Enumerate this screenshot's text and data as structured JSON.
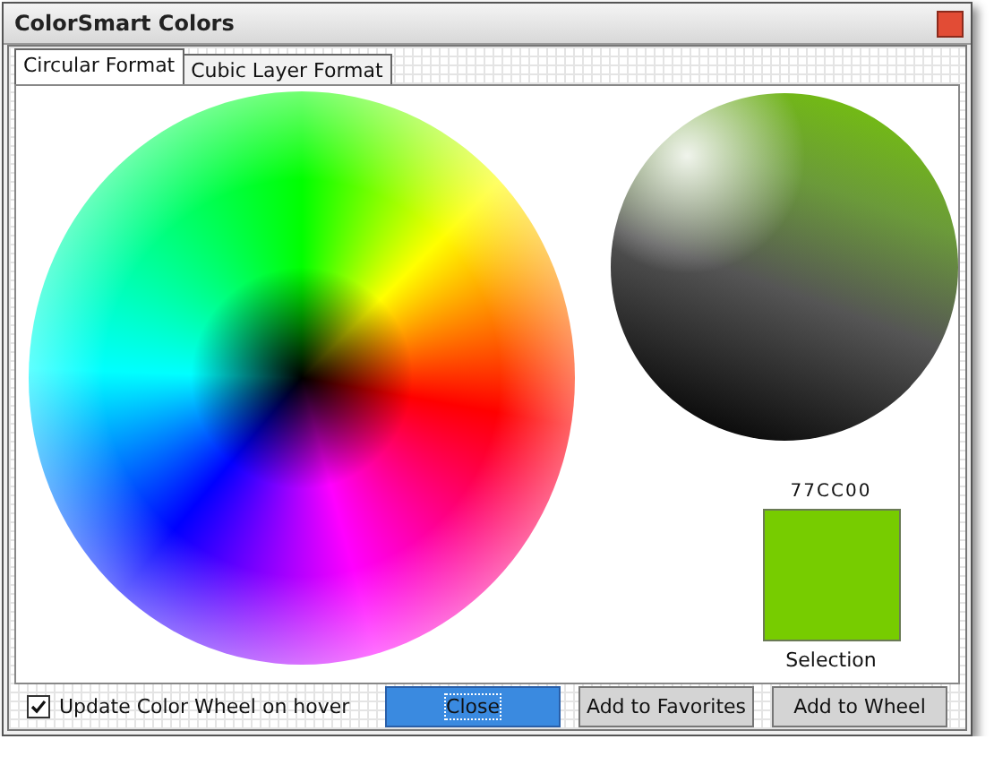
{
  "window": {
    "title": "ColorSmart Colors"
  },
  "tabs": [
    {
      "label": "Circular Format",
      "selected": true
    },
    {
      "label": "Cubic Layer Format",
      "selected": false
    }
  ],
  "selection": {
    "hex": "77CC00",
    "label": "Selection"
  },
  "footer": {
    "checkbox": {
      "label": "Update Color Wheel on hover",
      "checked": true
    },
    "buttons": [
      {
        "label": "Close",
        "focused": true
      },
      {
        "label": "Add to Favorites",
        "focused": false
      },
      {
        "label": "Add to Wheel",
        "focused": false
      }
    ]
  }
}
